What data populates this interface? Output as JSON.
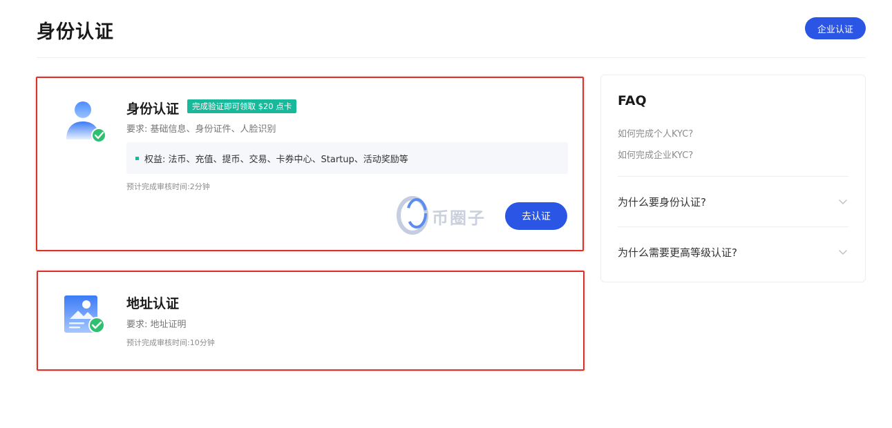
{
  "header": {
    "title": "身份认证",
    "enterprise_button": "企业认证"
  },
  "identity_card": {
    "title": "身份认证",
    "reward_badge": "完成验证即可领取 $20 点卡",
    "requirement": "要求: 基础信息、身份证件、人脸识别",
    "benefits": "权益: 法币、充值、提币、交易、卡券中心、Startup、活动奖励等",
    "estimated_time": "预计完成审核时间:2分钟",
    "verify_button": "去认证",
    "watermark": "币圈子"
  },
  "address_card": {
    "title": "地址认证",
    "requirement": "要求: 地址证明",
    "estimated_time": "预计完成审核时间:10分钟"
  },
  "faq": {
    "title": "FAQ",
    "links": [
      "如何完成个人KYC?",
      "如何完成企业KYC?"
    ],
    "items": [
      "为什么要身份认证?",
      "为什么需要更高等级认证?"
    ]
  },
  "colors": {
    "primary": "#2a55e5",
    "accent_green": "#18b89a",
    "highlight_border": "#d9322b"
  },
  "icons": {
    "identity": "user-verified-icon",
    "address": "address-doc-verified-icon",
    "watermark": "coin-circle-logo-icon",
    "faq_chevron": "chevron-down-icon"
  }
}
